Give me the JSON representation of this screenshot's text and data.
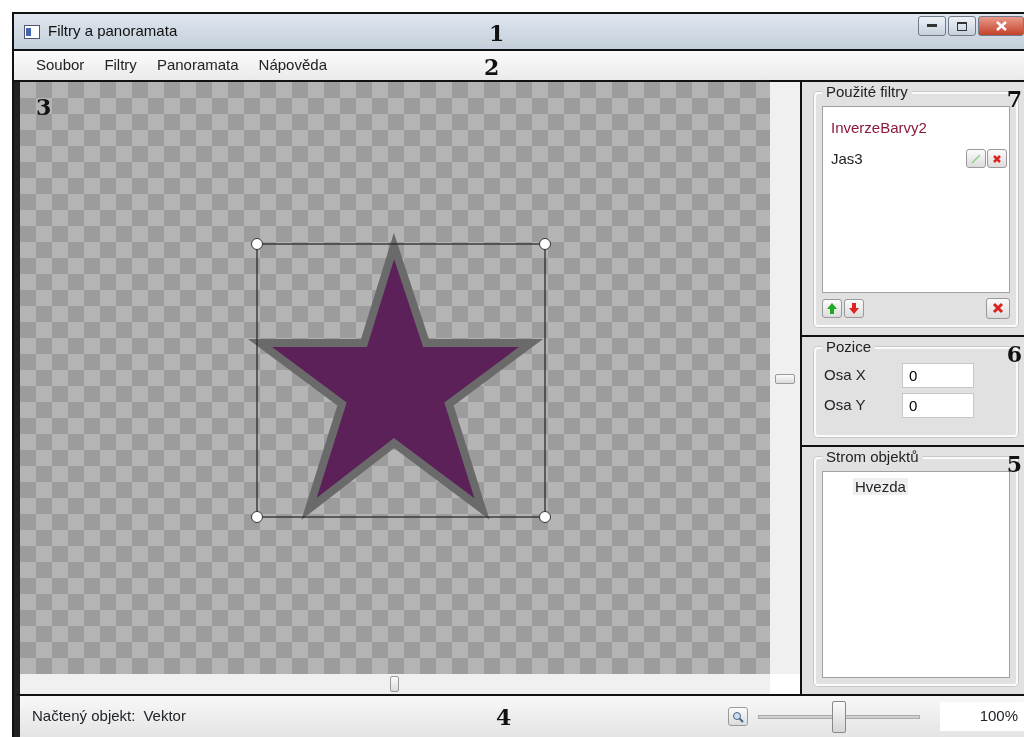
{
  "window": {
    "title": "Filtry a panoramata",
    "callout": "1"
  },
  "menu": {
    "items": [
      "Soubor",
      "Filtry",
      "Panoramata",
      "Nápověda"
    ],
    "callout": "2"
  },
  "canvas": {
    "callout": "3",
    "shape": {
      "kind": "star",
      "color": "#5c2158",
      "selected": true
    }
  },
  "filters": {
    "title": "Použité filtry",
    "callout": "7",
    "items": [
      {
        "label": "InverzeBarvy2",
        "selected": false
      },
      {
        "label": "Jas3",
        "selected": true
      }
    ]
  },
  "position": {
    "title": "Pozice",
    "callout": "6",
    "fields": [
      {
        "label": "Osa X",
        "value": "0"
      },
      {
        "label": "Osa Y",
        "value": "0"
      }
    ]
  },
  "object_tree": {
    "title": "Strom objektů",
    "callout": "5",
    "items": [
      {
        "label": "Hvezda",
        "selected": true
      }
    ]
  },
  "status_bar": {
    "label": "Načtený objekt:",
    "value": "Vektor",
    "callout": "4",
    "zoom": {
      "level": 0.5,
      "reading": "100%"
    }
  }
}
